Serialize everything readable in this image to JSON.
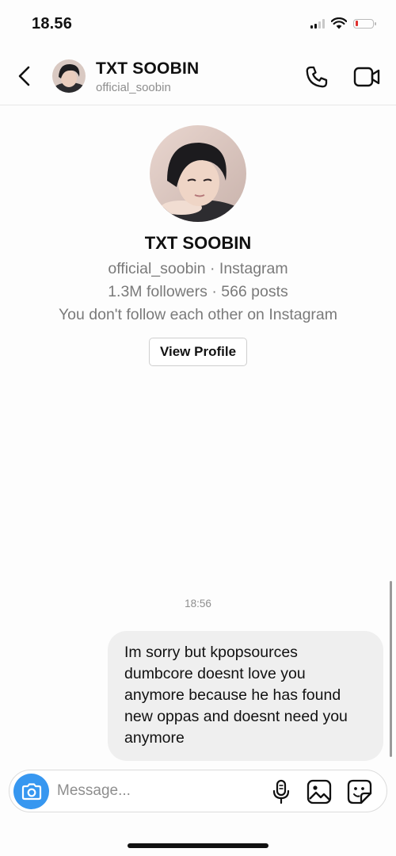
{
  "status_bar": {
    "time": "18.56",
    "battery_level": 0.1,
    "signal_bars": 2
  },
  "header": {
    "title": "TXT SOOBIN",
    "username": "official_soobin",
    "icons": [
      "back-chevron-icon",
      "avatar",
      "phone-icon",
      "video-camera-icon"
    ]
  },
  "profile": {
    "name": "TXT SOOBIN",
    "line1": "official_soobin · Instagram",
    "line2": "1.3M followers · 566 posts",
    "line3": "You don't follow each other on Instagram",
    "view_profile_label": "View Profile"
  },
  "chat": {
    "timestamp": "18:56",
    "messages": [
      {
        "sender": "me",
        "lines": [
          "Im sorry but kpopsources",
          "dumbcore doesnt love you",
          "anymore because he has found",
          "new oppas and doesnt need you",
          "anymore"
        ]
      }
    ]
  },
  "composer": {
    "placeholder": "Message...",
    "value": "",
    "icons": [
      "camera-icon",
      "microphone-icon",
      "gallery-icon",
      "sticker-icon"
    ]
  },
  "colors": {
    "accent": "#3797f0",
    "bubble_bg": "#efefef",
    "secondary_text": "#8e8e8e",
    "battery_low": "#e0312f"
  }
}
